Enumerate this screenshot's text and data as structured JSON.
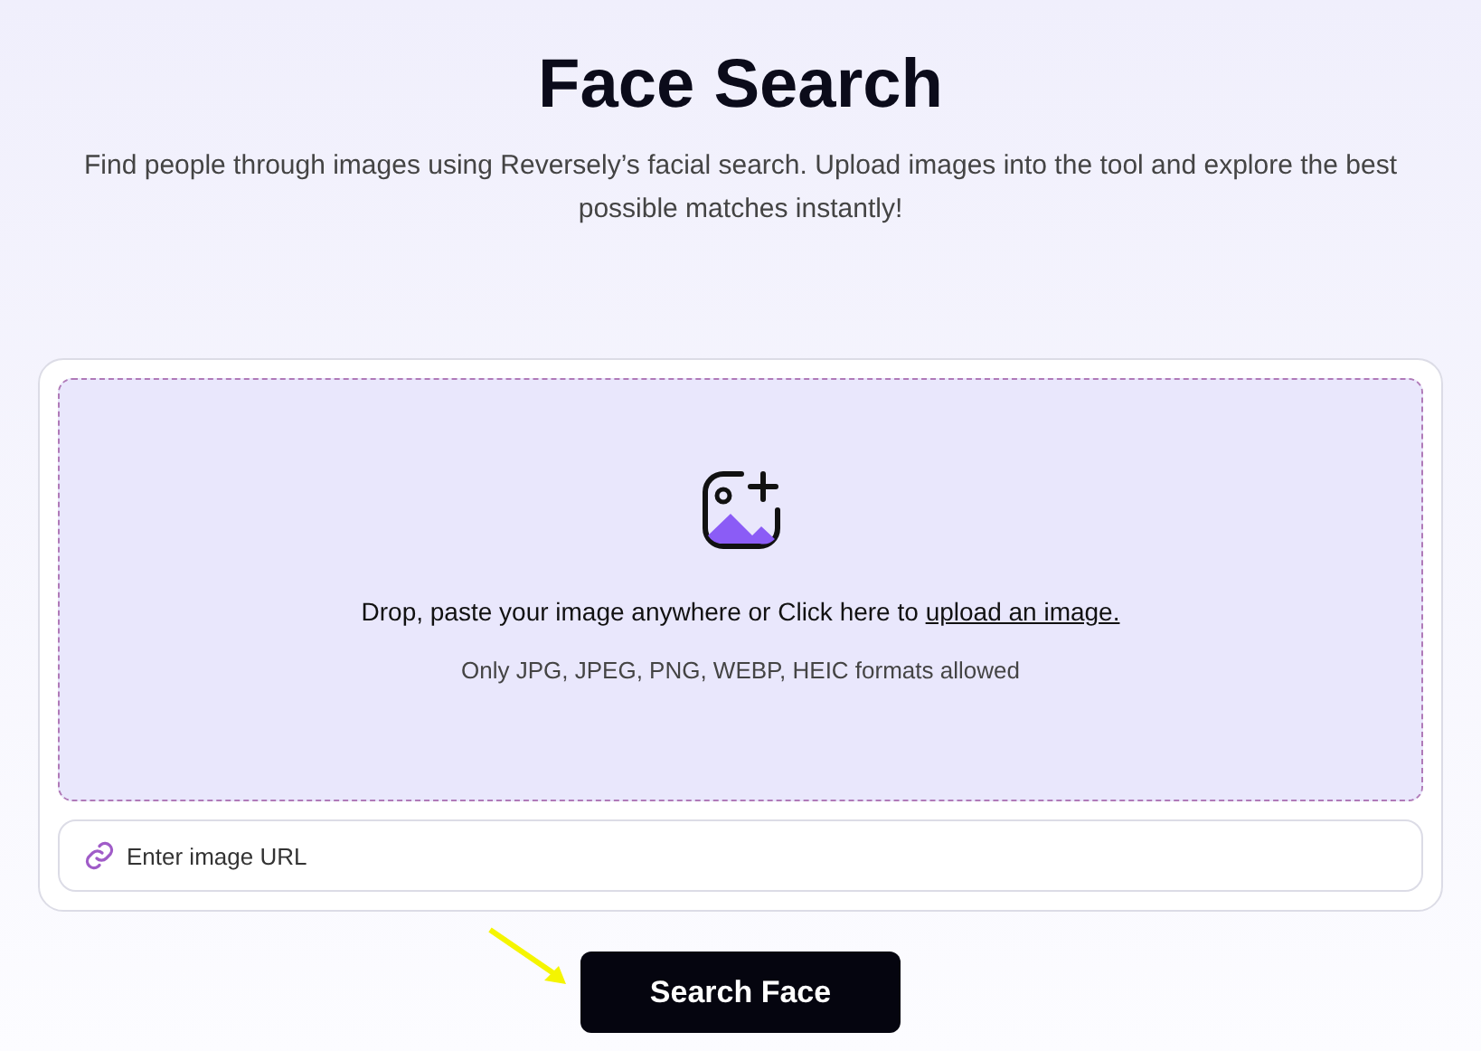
{
  "heading": "Face Search",
  "subtitle": "Find people through images using Reversely’s facial search. Upload images into the tool and explore the best possible matches instantly!",
  "dropzone": {
    "prompt": "Drop, paste your image anywhere or Click here to ",
    "link": "upload an image.",
    "formats": "Only JPG, JPEG, PNG, WEBP, HEIC formats allowed"
  },
  "url_field": {
    "placeholder": "Enter image URL"
  },
  "button": "Search Face"
}
